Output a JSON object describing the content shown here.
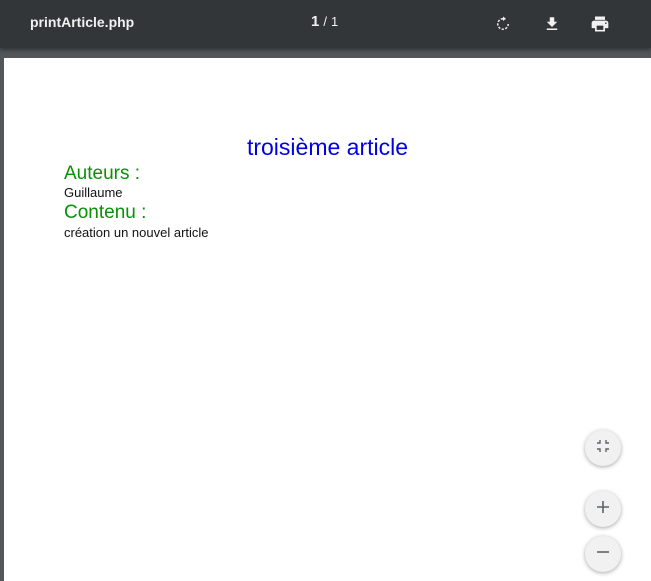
{
  "toolbar": {
    "title": "printArticle.php",
    "page_current": "1",
    "page_separator": "/",
    "page_total": "1",
    "icons": [
      "rotate-icon",
      "download-icon",
      "print-icon"
    ]
  },
  "document": {
    "title": "troisième article",
    "authors_heading": "Auteurs :",
    "authors_value": "Guillaume",
    "content_heading": "Contenu :",
    "content_value": "création un nouvel article"
  },
  "colors": {
    "toolbar_bg": "#323639",
    "viewer_bg": "#525659",
    "title_color": "#0000e6",
    "heading_color": "#069106"
  },
  "zoom_controls": [
    "fit-to-page-icon",
    "zoom-in-icon",
    "zoom-out-icon"
  ]
}
